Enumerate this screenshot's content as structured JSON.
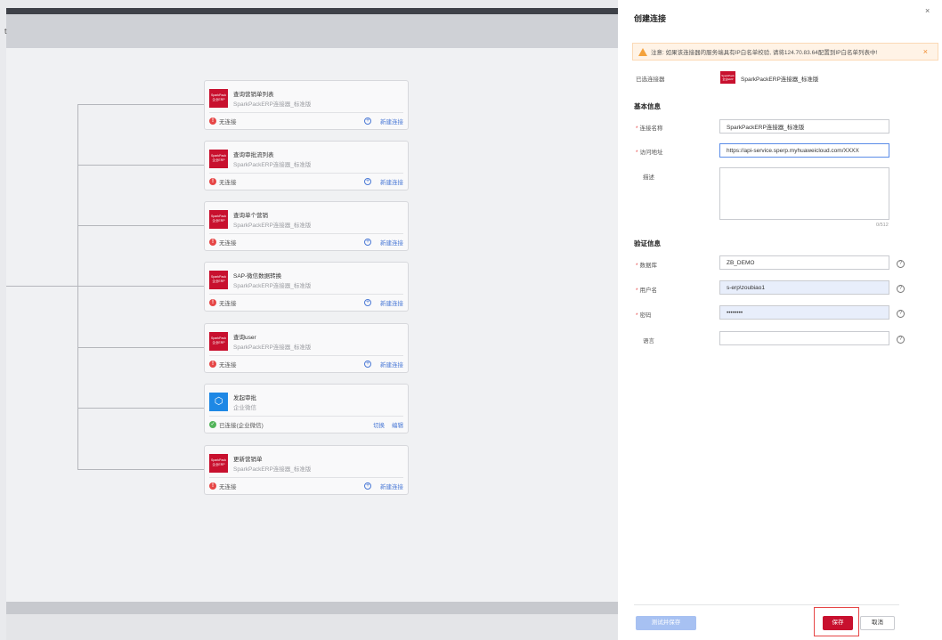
{
  "header": {
    "title_fragment": "t"
  },
  "nodes": [
    {
      "title": "查询营销单列表",
      "subtitle": "SparkPackERP连接器_标准版",
      "status": "无连接",
      "action": "新建连接",
      "logo_text": "SparkPack 企业ERP",
      "connected": false
    },
    {
      "title": "查询审批流列表",
      "subtitle": "SparkPackERP连接器_标准版",
      "status": "无连接",
      "action": "新建连接",
      "logo_text": "SparkPack 企业ERP",
      "connected": false
    },
    {
      "title": "查询单个营销",
      "subtitle": "SparkPackERP连接器_标准版",
      "status": "无连接",
      "action": "新建连接",
      "logo_text": "SparkPack 企业ERP",
      "connected": false
    },
    {
      "title": "SAP-微信数据转换",
      "subtitle": "SparkPackERP连接器_标准版",
      "status": "无连接",
      "action": "新建连接",
      "logo_text": "SparkPack 企业ERP",
      "connected": false
    },
    {
      "title": "查询user",
      "subtitle": "SparkPackERP连接器_标准版",
      "status": "无连接",
      "action": "新建连接",
      "logo_text": "SparkPack 企业ERP",
      "connected": false
    },
    {
      "title": "发起审批",
      "subtitle": "企业微信",
      "status": "已连接(企业微信)",
      "action": "切换",
      "action2": "编辑",
      "connected": true
    },
    {
      "title": "更新营销单",
      "subtitle": "SparkPackERP连接器_标准版",
      "status": "无连接",
      "action": "新建连接",
      "logo_text": "SparkPack 企业ERP",
      "connected": false
    }
  ],
  "drawer": {
    "title": "创建连接",
    "close": "×",
    "warning": "注意: 如果该连接器的服务端具有IP白名单校验, 请将124.70.83.64配置到IP白名单列表中!",
    "selected_label": "已选连接器",
    "selected_logo_text": "SparkPack 企业ERP",
    "selected_name": "SparkPackERP连接器_标准版",
    "basic_section": "基本信息",
    "name_label": "连接名称",
    "name_value": "SparkPackERP连接器_标准版",
    "url_label": "访问地址",
    "url_value": "https://api-service.sperp.myhuaweicloud.com/XXXX",
    "desc_label": "描述",
    "desc_count": "0/512",
    "auth_section": "验证信息",
    "db_label": "数据库",
    "db_value": "ZB_DEMO",
    "user_label": "用户名",
    "user_value": "s-erp\\zoubiao1",
    "pwd_label": "密码",
    "pwd_value": "••••••••",
    "lang_label": "语言",
    "lang_value": "",
    "help_icon": "?",
    "test_save_button": "测试并保存",
    "save_button": "保存",
    "cancel_button": "取消"
  },
  "colors": {
    "brand_red": "#c8102e",
    "link_blue": "#4a79d6",
    "error_red": "#e64646",
    "ok_green": "#52b45a"
  }
}
